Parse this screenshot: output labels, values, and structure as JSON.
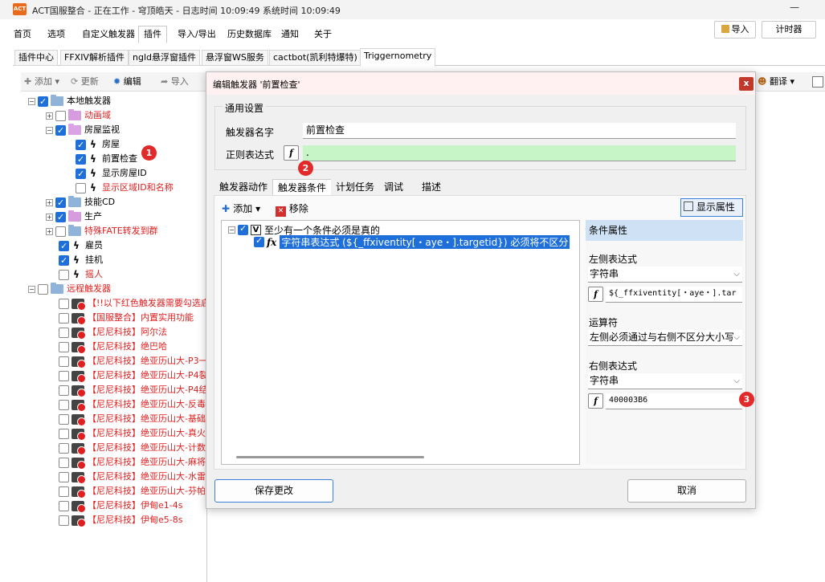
{
  "window": {
    "title": "ACT国服整合 - 正在工作 - 穹顶皓天 - 日志时间 10:09:49 系统时间 10:09:49",
    "logo": "ACT",
    "min": "—"
  },
  "menu": [
    "首页",
    "选项",
    "自定义触发器",
    "插件",
    "导入/导出",
    "历史数据库",
    "通知",
    "关于"
  ],
  "right_buttons": {
    "import": "导入",
    "timer": "计时器"
  },
  "plugin_tabs": [
    "插件中心",
    "FFXIV解析插件",
    "ngld悬浮窗插件",
    "悬浮窗WS服务",
    "cactbot(凯利特爆特)",
    "Triggernometry"
  ],
  "toolbar": {
    "add": "添加",
    "update": "更新",
    "edit": "编辑",
    "import": "导入",
    "translate": "翻译"
  },
  "tree": {
    "local": "本地触发器",
    "anim": "动画域",
    "house": "房屋监视",
    "house_items": [
      "房屋",
      "前置检查",
      "显示房屋ID",
      "显示区域ID和名称"
    ],
    "skills": "技能CD",
    "production": "生产",
    "fate": "特殊FATE转发到群",
    "hire": "雇员",
    "afk": "挂机",
    "shake": "摇人",
    "remote": "远程触发器",
    "remote_items": [
      "【!!以下红色触发器需要勾选启",
      "【国服整合】内置实用功能",
      "【尼尼科技】阿尔法",
      "【尼尼科技】绝巴哈",
      "【尼尼科技】绝亚历山大-P3一",
      "【尼尼科技】绝亚历山大-P4裂",
      "【尼尼科技】绝亚历山大-P4结",
      "【尼尼科技】绝亚历山大-反毒",
      "【尼尼科技】绝亚历山大-基础",
      "【尼尼科技】绝亚历山大-真火",
      "【尼尼科技】绝亚历山大-计数",
      "【尼尼科技】绝亚历山大-麻将",
      "【尼尼科技】绝亚历山大-水雷",
      "【尼尼科技】绝亚历山大-芬帕",
      "【尼尼科技】伊甸e1-4s",
      "【尼尼科技】伊甸e5-8s"
    ]
  },
  "badges": [
    "1",
    "2",
    "3"
  ],
  "dialog": {
    "title": "编辑触发器 '前置检查'",
    "close": "x",
    "general": "通用设置",
    "name_label": "触发器名字",
    "name_value": "前置检查",
    "regex_label": "正则表达式",
    "regex_value": ".",
    "fx": "f",
    "tabs": [
      "触发器动作",
      "触发器条件",
      "计划任务",
      "调试",
      "描述"
    ],
    "cond_add": "添加",
    "cond_remove": "移除",
    "show_props": "显示属性",
    "cond_root": "至少有一个条件必须是真的",
    "cond_child": "字符串表达式 (${_ffxiventity[・aye・].targetid}) 必须将不区分",
    "props_title": "条件属性",
    "left_label": "左侧表达式",
    "left_type": "字符串",
    "left_expr": "${_ffxiventity[・aye・].tar",
    "op_label": "运算符",
    "op_value": "左侧必须通过与右侧不区分大小写",
    "right_label": "右侧表达式",
    "right_type": "字符串",
    "right_expr": "400003B6",
    "save": "保存更改",
    "cancel": "取消"
  }
}
